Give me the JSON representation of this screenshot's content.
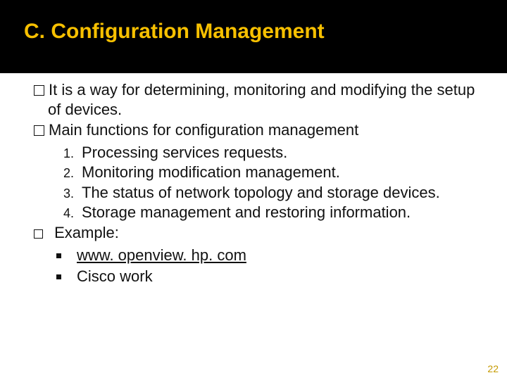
{
  "title": "C. Configuration Management",
  "para1_prefix": "It",
  "para1_rest": " is a way for determining, monitoring and modifying the setup of devices.",
  "para2_prefix": "Main",
  "para2_rest": " functions for configuration management",
  "list": {
    "i1": "Processing services requests.",
    "i2": "Monitoring modification management.",
    "i3": "The status of network topology and storage devices.",
    "i4": "Storage management and restoring information."
  },
  "example_label": " Example:",
  "sub": {
    "s1": "www. openview. hp. com",
    "s2": "Cisco work"
  },
  "page_number": "22"
}
